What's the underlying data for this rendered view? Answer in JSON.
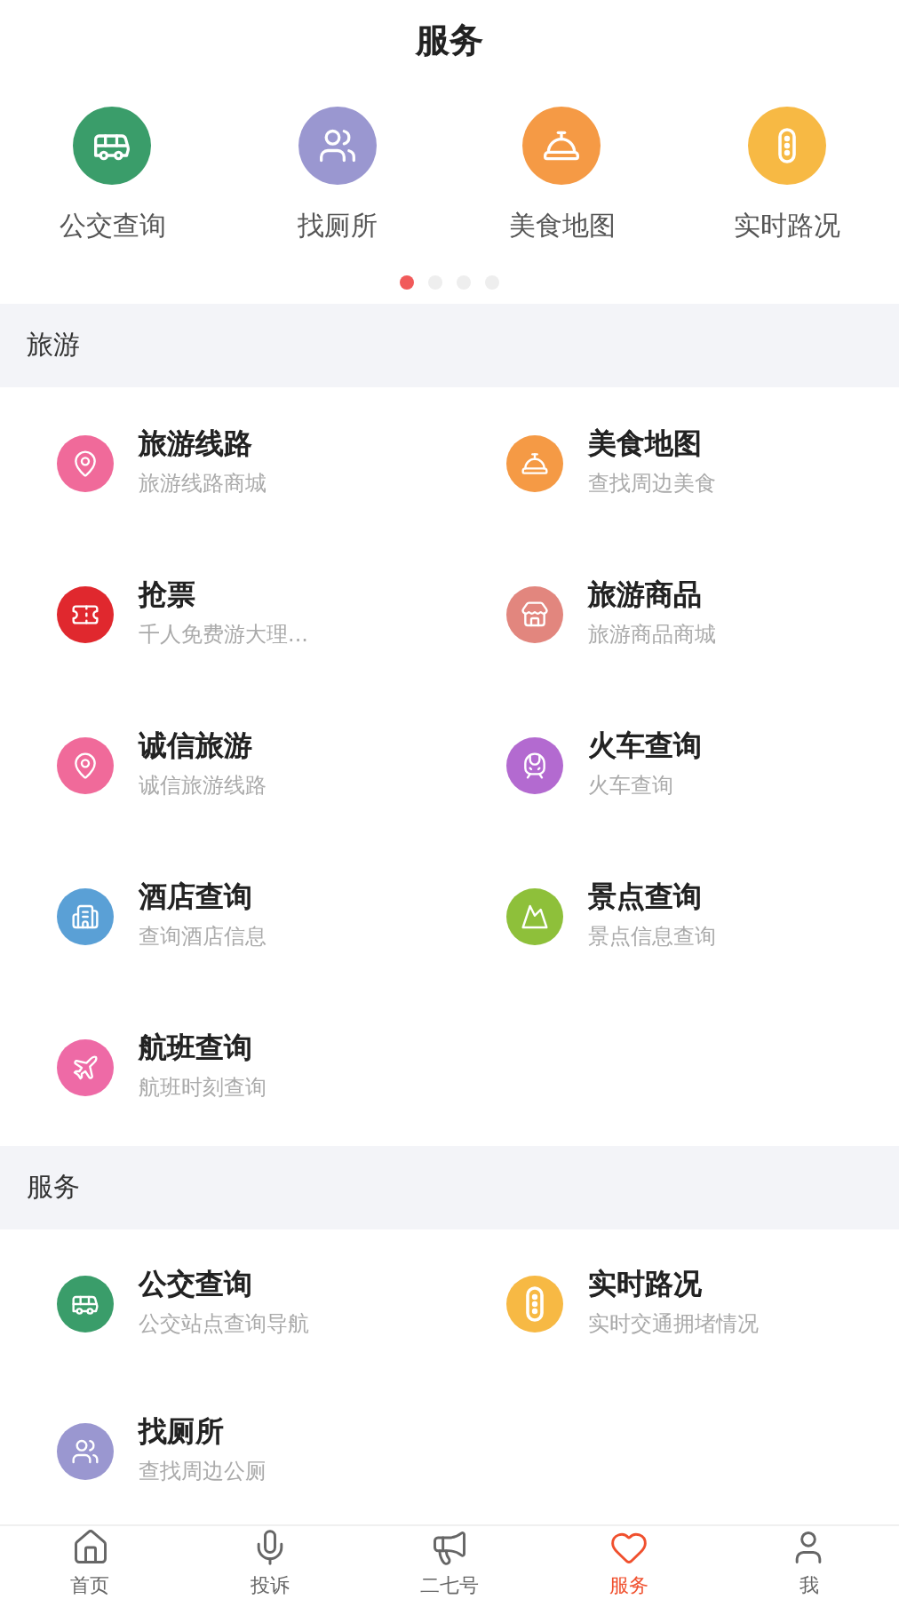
{
  "title": "服务",
  "quick_links": [
    {
      "label": "公交查询",
      "color": "#3a9d6a"
    },
    {
      "label": "找厕所",
      "color": "#9a97d0"
    },
    {
      "label": "美食地图",
      "color": "#f59a45"
    },
    {
      "label": "实时路况",
      "color": "#f7b944"
    }
  ],
  "carousel_dots": [
    {
      "selected": true
    },
    {
      "selected": false
    },
    {
      "selected": false
    },
    {
      "selected": false
    }
  ],
  "sections": [
    {
      "title": "旅游",
      "items": [
        {
          "name": "旅游线路",
          "desc": "旅游线路商城",
          "color": "#f06a9a"
        },
        {
          "name": "美食地图",
          "desc": "查找周边美食",
          "color": "#f59a45"
        },
        {
          "name": "抢票",
          "desc": "千人免费游大理...",
          "color": "#e0282e"
        },
        {
          "name": "旅游商品",
          "desc": "旅游商品商城",
          "color": "#e2867e"
        },
        {
          "name": "诚信旅游",
          "desc": "诚信旅游线路",
          "color": "#f06a9a"
        },
        {
          "name": "火车查询",
          "desc": "火车查询",
          "color": "#b36ad0"
        },
        {
          "name": "酒店查询",
          "desc": "查询酒店信息",
          "color": "#5aa0d6"
        },
        {
          "name": "景点查询",
          "desc": "景点信息查询",
          "color": "#8ec03a"
        },
        {
          "name": "航班查询",
          "desc": "航班时刻查询",
          "color": "#ee6aa6"
        }
      ]
    },
    {
      "title": "服务",
      "items": [
        {
          "name": "公交查询",
          "desc": "公交站点查询导航",
          "color": "#3a9d6a"
        },
        {
          "name": "实时路况",
          "desc": "实时交通拥堵情况",
          "color": "#f7b944"
        },
        {
          "name": "找厕所",
          "desc": "查找周边公厕",
          "color": "#9a97d0"
        }
      ]
    }
  ],
  "tab_bar": [
    {
      "label": "首页",
      "selected": false
    },
    {
      "label": "投诉",
      "selected": false
    },
    {
      "label": "二七号",
      "selected": false
    },
    {
      "label": "服务",
      "selected": true
    },
    {
      "label": "我",
      "selected": false
    }
  ]
}
